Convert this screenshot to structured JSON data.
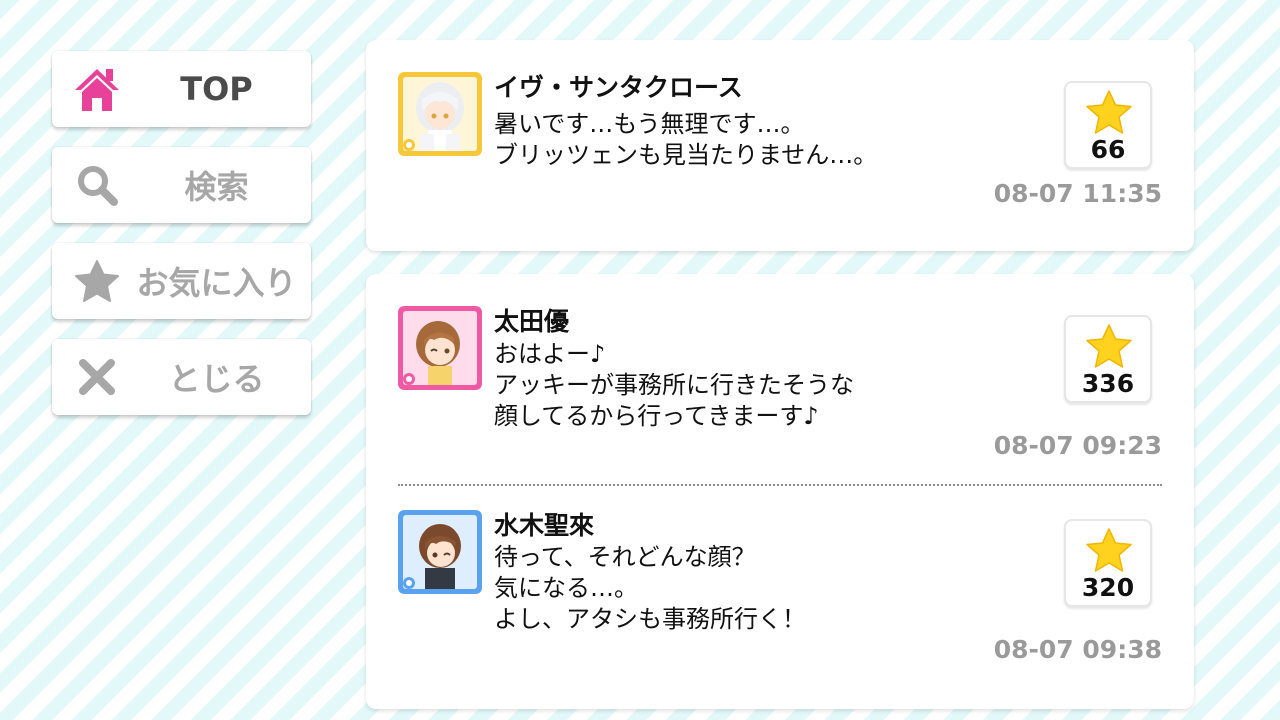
{
  "nav": {
    "top_label": "TOP",
    "search_label": "検索",
    "favorites_label": "お気に入り",
    "close_label": "とじる"
  },
  "cards": [
    {
      "posts": [
        {
          "name": "イヴ・サンタクロース",
          "text": "暑いです…もう無理です…。\nブリッツェンも見当たりません…。",
          "time": "08-07 11:35",
          "favorites": "66"
        }
      ]
    },
    {
      "posts": [
        {
          "name": "太田優",
          "text": "おはよー♪\nアッキーが事務所に行きたそうな\n顔してるから行ってきまーす♪",
          "time": "08-07 09:23",
          "favorites": "336"
        },
        {
          "name": "水木聖來",
          "text": "待って、それどんな顔？\n気になる…。\nよし、アタシも事務所行く！",
          "time": "08-07 09:38",
          "favorites": "320"
        }
      ]
    }
  ],
  "colors": {
    "accent_pink": "#e8419a",
    "icon_gray": "#a7a7a7",
    "star_yellow": "#ffd21f",
    "stripe": "#e2f8f9",
    "avatar_frame_yellow": "#f7c73a",
    "avatar_frame_pink": "#f05aa5",
    "avatar_frame_blue": "#5aa2ef"
  },
  "icons": {
    "top": "home-icon",
    "search": "search-icon",
    "favorites": "star-icon",
    "close": "close-icon"
  }
}
